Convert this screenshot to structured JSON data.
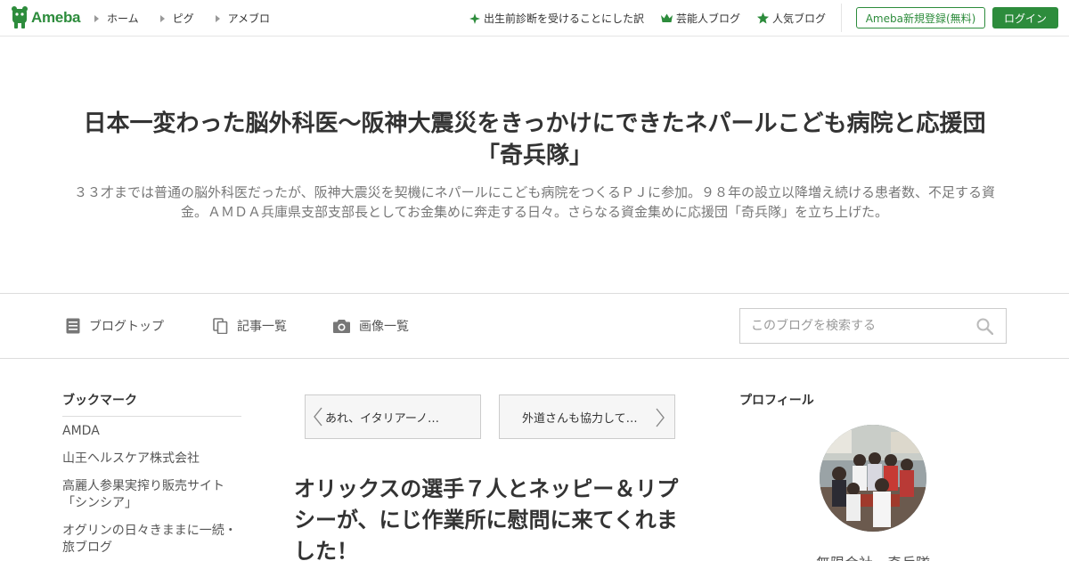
{
  "topbar": {
    "logo_text": "Ameba",
    "nav_left": [
      "ホーム",
      "ピグ",
      "アメブロ"
    ],
    "nav_right": [
      {
        "icon": "leaf-icon",
        "label": "出生前診断を受けることにした訳"
      },
      {
        "icon": "crown-icon",
        "label": "芸能人ブログ"
      },
      {
        "icon": "star-icon",
        "label": "人気ブログ"
      }
    ],
    "register_label": "Ameba新規登録(無料)",
    "login_label": "ログイン",
    "brand_color": "#2d8c3c"
  },
  "header": {
    "title_line1": "日本一変わった脳外科医～阪神大震災をきっかけにできたネパールこども病院と応援団",
    "title_line2": "「奇兵隊」",
    "desc_line1": "３３才までは普通の脳外科医だったが、阪神大震災を契機にネパールにこども病院をつくるＰＪに参加。９８年の設立以降増え続ける患者数、不足する資",
    "desc_line2": "金。ＡＭＤＡ兵庫県支部支部長としてお金集めに奔走する日々。さらなる資金集めに応援団「奇兵隊」を立ち上げた。"
  },
  "blognav": {
    "items": [
      {
        "icon": "document-icon",
        "label": "ブログトップ"
      },
      {
        "icon": "copy-icon",
        "label": "記事一覧"
      },
      {
        "icon": "camera-icon",
        "label": "画像一覧"
      }
    ],
    "search_placeholder": "このブログを検索する"
  },
  "sidebar_left": {
    "heading": "ブックマーク",
    "items": [
      "AMDA",
      "山王ヘルスケア株式会社",
      "高麗人参果実搾り販売サイト「シンシア」",
      "オグリンの日々きままに一続・旅ブログ"
    ]
  },
  "main": {
    "prev_label": "あれ、イタリアーノ…",
    "next_label": "外道さんも協力して…",
    "entry_title": "オリックスの選手７人とネッピー＆リプシーが、にじ作業所に慰問に来てくれました！"
  },
  "sidebar_right": {
    "heading": "プロフィール",
    "profile_name": "無限会社　奇兵隊"
  }
}
